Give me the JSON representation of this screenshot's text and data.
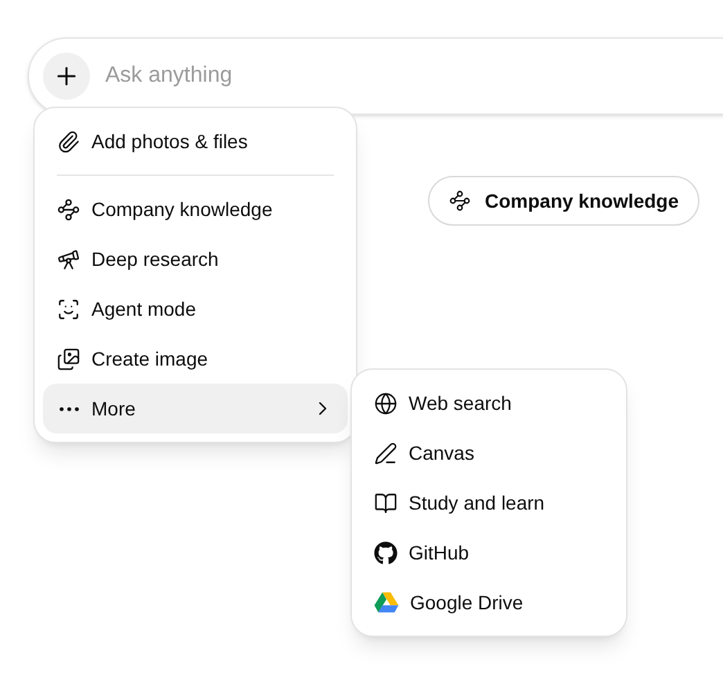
{
  "composer": {
    "placeholder": "Ask anything"
  },
  "chip": {
    "label": "Company knowledge"
  },
  "menu": {
    "items": [
      {
        "kind": "action",
        "label": "Add photos & files",
        "selected": false
      },
      {
        "kind": "divider"
      },
      {
        "kind": "action",
        "label": "Company knowledge",
        "selected": false
      },
      {
        "kind": "action",
        "label": "Deep research",
        "selected": false
      },
      {
        "kind": "action",
        "label": "Agent mode",
        "selected": false
      },
      {
        "kind": "action",
        "label": "Create image",
        "selected": false
      },
      {
        "kind": "submenu",
        "label": "More",
        "selected": true
      }
    ]
  },
  "submenu": {
    "items": [
      {
        "label": "Web search"
      },
      {
        "label": "Canvas"
      },
      {
        "label": "Study and learn"
      },
      {
        "label": "GitHub"
      },
      {
        "label": "Google Drive"
      }
    ]
  }
}
